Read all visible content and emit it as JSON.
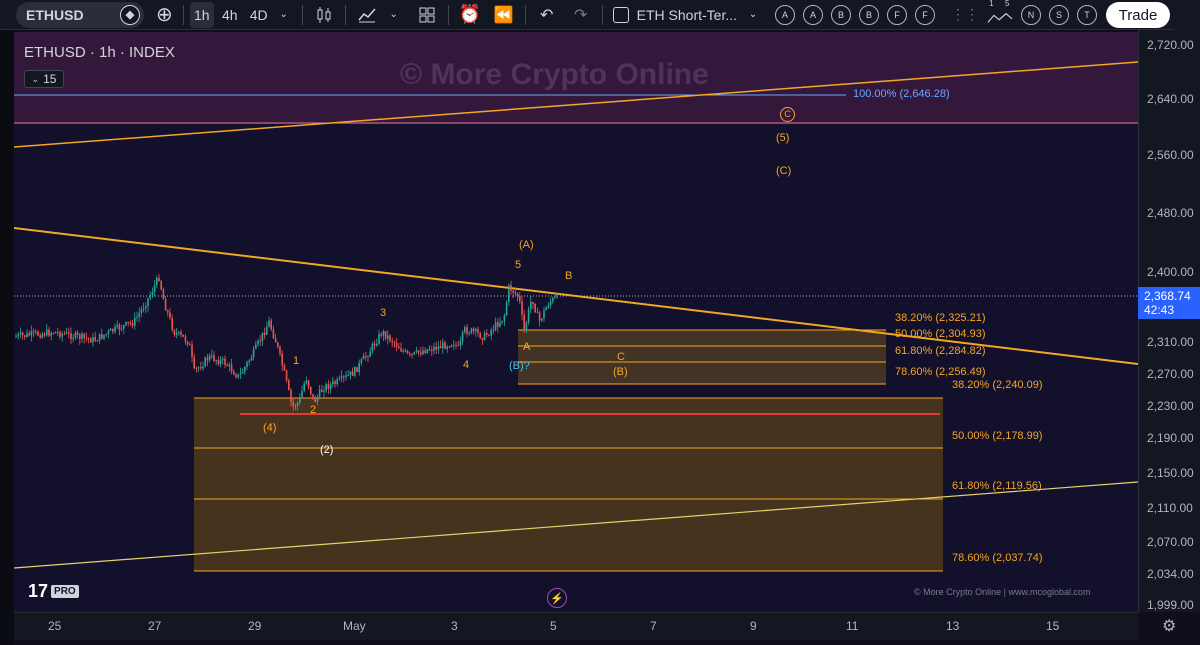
{
  "toolbar": {
    "symbol": "ETHUSD",
    "intervals": [
      "1h",
      "4h",
      "4D"
    ],
    "active_interval": "1h",
    "layout_name": "ETH Short-Ter...",
    "alert_letters": [
      "A",
      "A",
      "B",
      "B",
      "F",
      "F"
    ],
    "indicator_numbers": [
      "1",
      "5"
    ],
    "extra_letters": [
      "N",
      "S",
      "T"
    ],
    "trade_label": "Trade"
  },
  "legend": {
    "title": "ETHUSD · 1h · INDEX",
    "interval_box": "15"
  },
  "watermark": "© More Crypto Online",
  "price_axis": {
    "labels": [
      "2,720.00",
      "2,640.00",
      "2,560.00",
      "2,480.00",
      "2,400.00",
      "2,310.00",
      "2,270.00",
      "2,230.00",
      "2,190.00",
      "2,150.00",
      "2,110.00",
      "2,070.00",
      "2,034.00",
      "1,999.00"
    ],
    "current_price": "2,368.74",
    "countdown": "42:43"
  },
  "time_axis": {
    "labels": [
      "25",
      "27",
      "29",
      "May",
      "3",
      "5",
      "7",
      "9",
      "11",
      "13",
      "15"
    ]
  },
  "fib_levels": {
    "upper": [
      "100.00% (2,646.28)"
    ],
    "small_box": [
      "38.20% (2,325.21)",
      "50.00% (2,304.93)",
      "61.80% (2,284.82)",
      "78.60% (2,256.49)"
    ],
    "large_box": [
      "38.20% (2,240.09)",
      "50.00% (2,178.99)",
      "61.80% (2,119.56)",
      "78.60% (2,037.74)"
    ]
  },
  "wave_labels": {
    "circled_c": "C",
    "five_paren": "(5)",
    "c_paren": "(C)",
    "a_paren": "(A)",
    "five": "5",
    "b": "B",
    "three": "3",
    "four": "4",
    "one": "1",
    "two": "2",
    "four_paren": "(4)",
    "two_paren": "(2)",
    "a": "A",
    "b_paren_blue": "(B)?",
    "c": "C",
    "b_paren": "(B)"
  },
  "footer": {
    "tv_logo": "17",
    "pro": "PRO",
    "credit": "© More Crypto Online   |   www.mcoglobal.com"
  },
  "colors": {
    "orange": "#f5a623",
    "blue": "#2962ff",
    "purple_zone": "#3a1a3f",
    "red_line": "#e53935"
  }
}
